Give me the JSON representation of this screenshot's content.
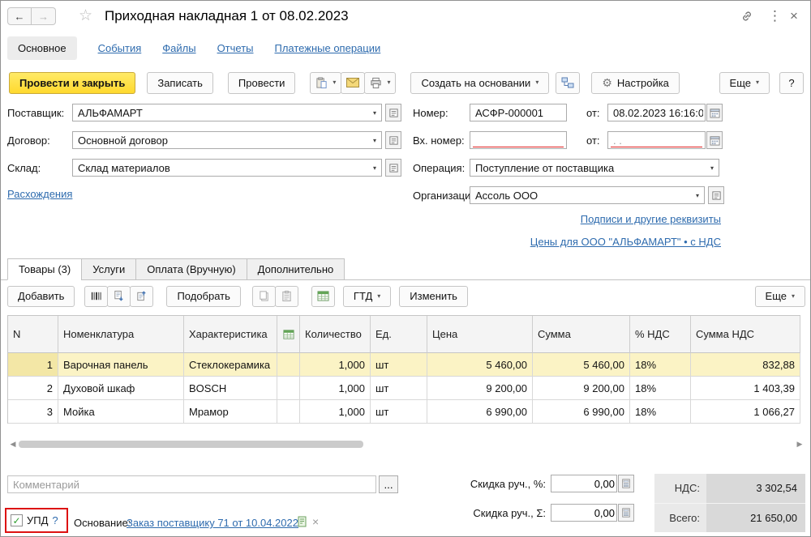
{
  "theme": {
    "accent_yellow": "#FFD92E",
    "link_color": "#2E6BAE",
    "selected_row_color": "#FBF3C5",
    "required_field_red": "#E02020",
    "annotation_red": "#DD1111"
  },
  "titlebar": {
    "title": "Приходная накладная 1 от 08.02.2023"
  },
  "nav": {
    "tabs": [
      {
        "label": "Основное",
        "active": true
      },
      {
        "label": "События",
        "active": false
      },
      {
        "label": "Файлы",
        "active": false
      },
      {
        "label": "Отчеты",
        "active": false
      },
      {
        "label": "Платежные операции",
        "active": false
      }
    ]
  },
  "toolbar": {
    "post_and_close": "Провести и закрыть",
    "write": "Записать",
    "post": "Провести",
    "create_on_base": "Создать на основании",
    "settings": "Настройка",
    "more": "Еще",
    "help": "?"
  },
  "form": {
    "supplier": {
      "label": "Поставщик:",
      "value": "АЛЬФАМАРТ"
    },
    "contract": {
      "label": "Договор:",
      "value": "Основной договор"
    },
    "warehouse": {
      "label": "Склад:",
      "value": "Склад материалов"
    },
    "discrepancies_link": "Расхождения",
    "number": {
      "label": "Номер:",
      "value": "АСФР-000001"
    },
    "date": {
      "label": "от:",
      "value": "08.02.2023 16:16:0"
    },
    "incoming_number": {
      "label": "Вх. номер:",
      "value": ""
    },
    "incoming_date": {
      "label": "от:",
      "value": ".  ."
    },
    "operation": {
      "label": "Операция:",
      "value": "Поступление от поставщика"
    },
    "organization": {
      "label": "Организация:",
      "value": "Ассоль ООО"
    },
    "signatures_link": "Подписи и другие реквизиты",
    "prices_link": "Цены для ООО \"АЛЬФАМАРТ\" • с НДС"
  },
  "sections": {
    "tabs": [
      {
        "label": "Товары (3)",
        "active": true
      },
      {
        "label": "Услуги",
        "active": false
      },
      {
        "label": "Оплата (Вручную)",
        "active": false
      },
      {
        "label": "Дополнительно",
        "active": false
      }
    ]
  },
  "items_toolbar": {
    "add": "Добавить",
    "pick": "Подобрать",
    "gtd": "ГТД",
    "edit": "Изменить",
    "more": "Еще"
  },
  "items_table": {
    "columns": [
      "N",
      "Номенклатура",
      "Характеристика",
      "",
      "Количество",
      "Ед.",
      "Цена",
      "Сумма",
      "% НДС",
      "Сумма НДС"
    ],
    "rows": [
      {
        "n": "1",
        "name": "Варочная панель",
        "characteristic": "Стеклокерамика",
        "quantity": "1,000",
        "unit": "шт",
        "price": "5 460,00",
        "sum": "5 460,00",
        "vat_percent": "18%",
        "vat_sum": "832,88",
        "selected": true
      },
      {
        "n": "2",
        "name": "Духовой шкаф",
        "characteristic": "BOSCH",
        "quantity": "1,000",
        "unit": "шт",
        "price": "9 200,00",
        "sum": "9 200,00",
        "vat_percent": "18%",
        "vat_sum": "1 403,39",
        "selected": false
      },
      {
        "n": "3",
        "name": "Мойка",
        "characteristic": "Мрамор",
        "quantity": "1,000",
        "unit": "шт",
        "price": "6 990,00",
        "sum": "6 990,00",
        "vat_percent": "18%",
        "vat_sum": "1 066,27",
        "selected": false
      }
    ]
  },
  "footer": {
    "comment_placeholder": "Комментарий",
    "comment_dots": "...",
    "discount_percent": {
      "label": "Скидка руч., %:",
      "value": "0,00"
    },
    "discount_sum": {
      "label": "Скидка руч., Σ:",
      "value": "0,00"
    },
    "totals": {
      "vat_label": "НДС:",
      "vat_value": "3 302,54",
      "total_label": "Всего:",
      "total_value": "21 650,00"
    },
    "upd": {
      "label": "УПД",
      "help": "?",
      "checked": true
    },
    "basis": {
      "label": "Основание:",
      "link": "Заказ поставщику 71 от 10.04.2022"
    }
  },
  "icons": {
    "back": "←",
    "forward": "→",
    "star": "☆",
    "menu": "⋮",
    "close": "×",
    "dropdown": "▾",
    "gear": "⚙",
    "scroll_left": "◀",
    "scroll_right": "▶",
    "check": "✓",
    "remove": "×"
  }
}
